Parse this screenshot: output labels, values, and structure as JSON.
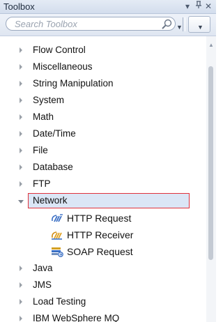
{
  "panel": {
    "title": "Toolbox",
    "pin_glyph": "▾",
    "pin_symbol": "p",
    "close_glyph": "✕"
  },
  "search": {
    "placeholder": "Search Toolbox",
    "icon": "magnifier-icon"
  },
  "tree": {
    "items": [
      {
        "label": "Flow Control",
        "expanded": false
      },
      {
        "label": "Miscellaneous",
        "expanded": false
      },
      {
        "label": "String Manipulation",
        "expanded": false
      },
      {
        "label": "System",
        "expanded": false
      },
      {
        "label": "Math",
        "expanded": false
      },
      {
        "label": "Date/Time",
        "expanded": false
      },
      {
        "label": "File",
        "expanded": false
      },
      {
        "label": "Database",
        "expanded": false
      },
      {
        "label": "FTP",
        "expanded": false
      },
      {
        "label": "Network",
        "expanded": true,
        "selected": true
      },
      {
        "label": "HTTP Request",
        "child": true,
        "icon": "http-request-icon"
      },
      {
        "label": "HTTP Receiver",
        "child": true,
        "icon": "http-receiver-icon"
      },
      {
        "label": "SOAP Request",
        "child": true,
        "icon": "soap-request-icon"
      },
      {
        "label": "Java",
        "expanded": false
      },
      {
        "label": "JMS",
        "expanded": false
      },
      {
        "label": "Load Testing",
        "expanded": false
      },
      {
        "label": "IBM WebSphere MQ",
        "expanded": false
      }
    ]
  },
  "colors": {
    "selection_border": "#e0323c",
    "selection_fill": "#dbe6f6",
    "header_bg": "#d3dded"
  }
}
